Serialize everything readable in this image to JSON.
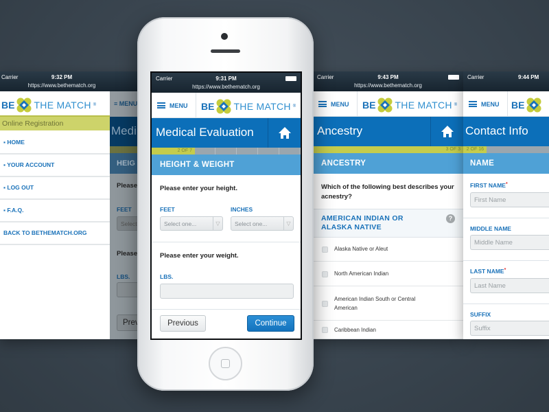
{
  "brand": {
    "be": "BE",
    "match": "THE MATCH",
    "reg": "®",
    "colors": {
      "blue": "#0c6fb9",
      "green": "#c5cc4c",
      "section": "#4fa1d6"
    }
  },
  "status_url": "https://www.bethematch.org",
  "carrier": "Carrier",
  "menu_label": "MENU",
  "screen_menu": {
    "time": "9:32 PM",
    "banner": "Online Registration",
    "items": [
      {
        "label": "HOME"
      },
      {
        "label": "YOUR ACCOUNT"
      },
      {
        "label": "LOG OUT"
      },
      {
        "label": "F.A.Q."
      },
      {
        "label": "BACK TO BETHEMATCH.ORG"
      }
    ],
    "behind": {
      "title": "Medi",
      "section": "HEIG",
      "question": "Please",
      "feet": "FEET",
      "select": "Select",
      "question2": "Please",
      "lbs": "LBS.",
      "prev": "Prev"
    }
  },
  "screen_medical": {
    "time": "9:31 PM",
    "title": "Medical Evaluation",
    "progress_label": "2 OF 7",
    "progress": 0.2857,
    "section": "HEIGHT & WEIGHT",
    "height_q": "Please enter your height.",
    "feet_label": "FEET",
    "inches_label": "INCHES",
    "feet_placeholder": "Select one...",
    "inches_placeholder": "Select one...",
    "weight_q": "Please enter your weight.",
    "lbs_label": "LBS.",
    "lbs_value": "",
    "previous": "Previous",
    "continue": "Continue"
  },
  "screen_ancestry": {
    "time": "9:43 PM",
    "title": "Ancestry",
    "progress_label": "3 OF 3",
    "progress": 1,
    "section": "ANCESTRY",
    "question": "Which of the following best describes your acnestry?",
    "group": "AMERICAN INDIAN OR ALASKA NATIVE",
    "options": [
      {
        "label": "Alaska Native or Aleut"
      },
      {
        "label": "North American Indian"
      },
      {
        "label": "American Indian South or Central American"
      },
      {
        "label": "Caribbean Indian"
      }
    ]
  },
  "screen_contact": {
    "time": "9:44 PM",
    "title": "Contact Info",
    "progress_label": "2 OF 16",
    "progress": 0.125,
    "section": "NAME",
    "fields": [
      {
        "label": "FIRST NAME",
        "required": "*",
        "placeholder": "First Name"
      },
      {
        "label": "MIDDLE NAME",
        "required": "",
        "placeholder": "Middle Name"
      },
      {
        "label": "LAST NAME",
        "required": "*",
        "placeholder": "Last Name"
      },
      {
        "label": "SUFFIX",
        "required": "",
        "placeholder": "Suffix"
      }
    ]
  }
}
